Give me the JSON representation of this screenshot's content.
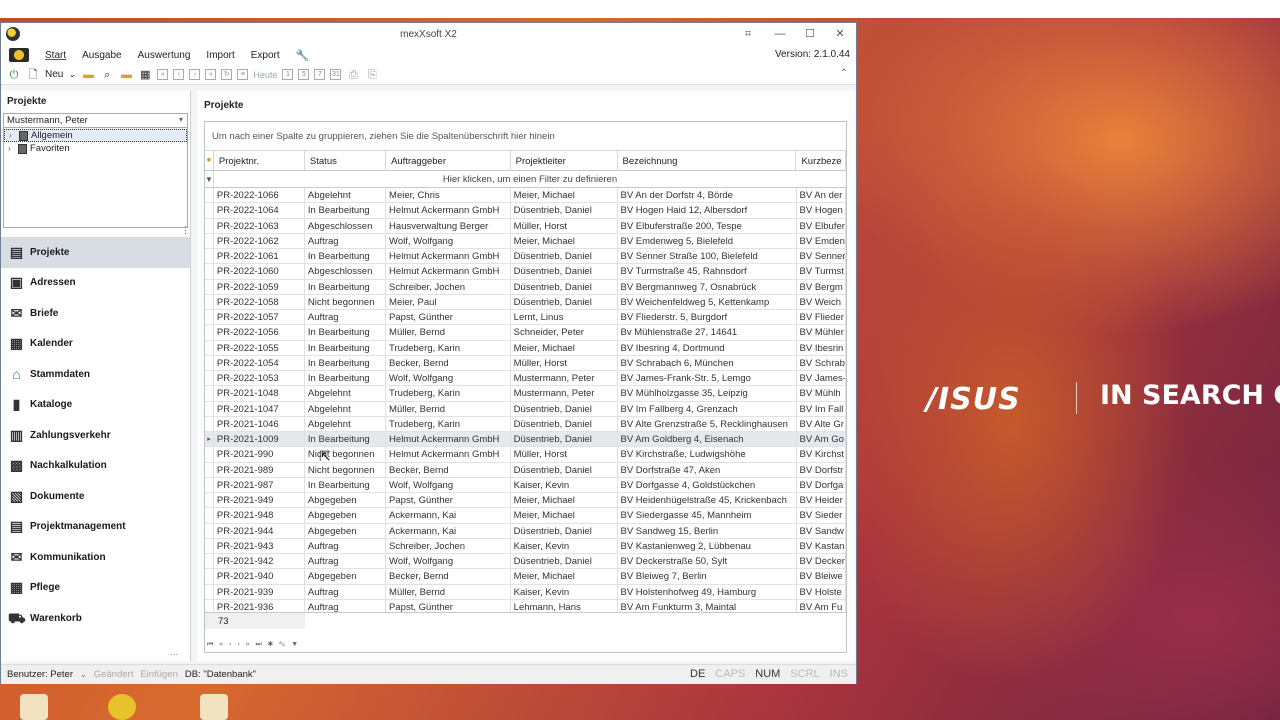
{
  "window": {
    "title": "mexXsoft X2",
    "version": "Version: 2.1.0.44"
  },
  "menu": {
    "tabs": [
      "Start",
      "Ausgabe",
      "Auswertung",
      "Import",
      "Export"
    ],
    "active": "Start"
  },
  "toolbar": {
    "new_label": "Neu",
    "today_label": "Heute"
  },
  "left_panel": {
    "title": "Projekte",
    "user_combo": "Mustermann, Peter",
    "tree": [
      {
        "label": "Allgemein",
        "selected": true
      },
      {
        "label": "Favoriten",
        "selected": false
      }
    ],
    "nav": [
      {
        "label": "Projekte",
        "icon": "folder-icon",
        "active": true
      },
      {
        "label": "Adressen",
        "icon": "address-card-icon"
      },
      {
        "label": "Briefe",
        "icon": "letters-icon"
      },
      {
        "label": "Kalender",
        "icon": "calendar-icon"
      },
      {
        "label": "Stammdaten",
        "icon": "home-icon"
      },
      {
        "label": "Kataloge",
        "icon": "catalog-icon"
      },
      {
        "label": "Zahlungsverkehr",
        "icon": "payment-icon"
      },
      {
        "label": "Nachkalkulation",
        "icon": "calculation-icon"
      },
      {
        "label": "Dokumente",
        "icon": "documents-icon"
      },
      {
        "label": "Projektmanagement",
        "icon": "project-management-icon"
      },
      {
        "label": "Kommunikation",
        "icon": "communication-icon"
      },
      {
        "label": "Pflege",
        "icon": "maintenance-icon"
      },
      {
        "label": "Warenkorb",
        "icon": "cart-icon"
      }
    ],
    "more": "..."
  },
  "content": {
    "title": "Projekte",
    "group_panel_hint": "Um nach einer Spalte zu gruppieren, ziehen Sie die Spaltenüberschrift hier hinein",
    "filter_hint": "Hier klicken, um einen Filter zu definieren",
    "columns": [
      "Projektnr.",
      "Status",
      "Auftraggeber",
      "Projektleiter",
      "Bezeichnung",
      "Kurzbeze"
    ],
    "rows": [
      [
        "PR-2022-1066",
        "Abgelehnt",
        "Meier, Chris",
        "Meier, Michael",
        "BV An der Dorfstr 4, Börde",
        "BV An der"
      ],
      [
        "PR-2022-1064",
        "In Bearbeitung",
        "Helmut Ackermann GmbH",
        "Düsentrieb, Daniel",
        "BV Hogen Haid 12, Albersdorf",
        "BV Hogen"
      ],
      [
        "PR-2022-1063",
        "Abgeschlossen",
        "Hausverwaltung Berger",
        "Müller, Horst",
        "BV Elbuferstraße 200, Tespe",
        "BV Elbufer"
      ],
      [
        "PR-2022-1062",
        "Auftrag",
        "Wolf, Wolfgang",
        "Meier, Michael",
        "BV Emdenweg 5, Bielefeld",
        "BV Emden"
      ],
      [
        "PR-2022-1061",
        "In Bearbeitung",
        "Helmut Ackermann GmbH",
        "Düsentrieb, Daniel",
        "BV Senner Straße 100, Bielefeld",
        "BV Senner"
      ],
      [
        "PR-2022-1060",
        "Abgeschlossen",
        "Helmut Ackermann GmbH",
        "Düsentrieb, Daniel",
        "BV Turmstraße 45, Rahnsdorf",
        "BV Turmst"
      ],
      [
        "PR-2022-1059",
        "In Bearbeitung",
        "Schreiber, Jochen",
        "Düsentrieb, Daniel",
        "BV Bergmannweg 7, Osnabrück",
        "BV Bergm"
      ],
      [
        "PR-2022-1058",
        "Nicht begonnen",
        "Meier, Paul",
        "Düsentrieb, Daniel",
        "BV Weichenfeldweg 5, Kettenkamp",
        "BV Weich"
      ],
      [
        "PR-2022-1057",
        "Auftrag",
        "Papst, Günther",
        "Lernt, Linus",
        "BV Fliederstr. 5, Burgdorf",
        "BV Flieder"
      ],
      [
        "PR-2022-1056",
        "In Bearbeitung",
        "Müller, Bernd",
        "Schneider, Peter",
        "Bv Mühlenstraße 27, 14641",
        "BV Mühler"
      ],
      [
        "PR-2022-1055",
        "In Bearbeitung",
        "Trudeberg, Karin",
        "Meier, Michael",
        "BV Ibesring 4, Dortmund",
        "BV Ibesrin"
      ],
      [
        "PR-2022-1054",
        "In Bearbeitung",
        "Becker, Bernd",
        "Müller, Horst",
        "BV Schrabach 6, München",
        "BV Schrab"
      ],
      [
        "PR-2022-1053",
        "In Bearbeitung",
        "Wolf, Wolfgang",
        "Mustermann, Peter",
        "BV James-Frank-Str. 5, Lemgo",
        "BV James-"
      ],
      [
        "PR-2021-1048",
        "Abgelehnt",
        "Trudeberg, Karin",
        "Mustermann, Peter",
        "BV Mühlholzgasse 35, Leipzig",
        "BV Mühlh"
      ],
      [
        "PR-2021-1047",
        "Abgelehnt",
        "Müller, Bernd",
        "Düsentrieb, Daniel",
        "BV Im Fallberg 4, Grenzach",
        "BV Im Fall"
      ],
      [
        "PR-2021-1046",
        "Abgelehnt",
        "Trudeberg, Karin",
        "Düsentrieb, Daniel",
        "BV Alte Grenzstraße 5, Recklinghausen",
        "BV Alte Gr"
      ],
      [
        "PR-2021-1009",
        "In Bearbeitung",
        "Helmut Ackermann GmbH",
        "Düsentrieb, Daniel",
        "BV Am Goldberg 4, Eisenach",
        "BV Am Go"
      ],
      [
        "PR-2021-990",
        "Nicht begonnen",
        "Helmut Ackermann GmbH",
        "Müller, Horst",
        "BV Kirchstraße, Ludwigshöhe",
        "BV Kirchst"
      ],
      [
        "PR-2021-989",
        "Nicht begonnen",
        "Becker, Bernd",
        "Düsentrieb, Daniel",
        "BV Dorfstraße 47, Aken",
        "BV Dorfstr"
      ],
      [
        "PR-2021-987",
        "In Bearbeitung",
        "Wolf, Wolfgang",
        "Kaiser, Kevin",
        "BV Dorfgasse 4, Goldstückchen",
        "BV Dorfga"
      ],
      [
        "PR-2021-949",
        "Abgegeben",
        "Papst, Günther",
        "Meier, Michael",
        "BV Heidenhügelstraße 45, Krickenbach",
        "BV Heider"
      ],
      [
        "PR-2021-948",
        "Abgegeben",
        "Ackermann, Kai",
        "Meier, Michael",
        "BV Siedergasse 45, Mannheim",
        "BV Sieder"
      ],
      [
        "PR-2021-944",
        "Abgegeben",
        "Ackermann, Kai",
        "Düsentrieb, Daniel",
        "BV Sandweg 15, Berlin",
        "BV Sandw"
      ],
      [
        "PR-2021-943",
        "Auftrag",
        "Schreiber, Jochen",
        "Kaiser, Kevin",
        "BV Kastanienweg 2, Lübbenau",
        "BV Kastan"
      ],
      [
        "PR-2021-942",
        "Auftrag",
        "Wolf, Wolfgang",
        "Düsentrieb, Daniel",
        "BV Deckerstraße 50, Sylt",
        "BV Decker"
      ],
      [
        "PR-2021-940",
        "Abgegeben",
        "Becker, Bernd",
        "Meier, Michael",
        "BV Bleiweg 7, Berlin",
        "BV Bleiwe"
      ],
      [
        "PR-2021-939",
        "Auftrag",
        "Müller, Bernd",
        "Kaiser, Kevin",
        "BV Holstenhofweg 49, Hamburg",
        "BV Holste"
      ],
      [
        "PR-2021-936",
        "Auftrag",
        "Papst, Günther",
        "Lehmann, Hans",
        "BV Am Funkturm 3, Maintal",
        "BV Am Fu"
      ]
    ],
    "current_row": 16,
    "count": "73"
  },
  "statusbar": {
    "user": "Benutzer: Peter",
    "changed": "Geändert",
    "inserted": "Einfügen",
    "db": "DB: \"Datenbank\"",
    "keys": [
      {
        "label": "DE",
        "on": true
      },
      {
        "label": "CAPS",
        "on": false
      },
      {
        "label": "NUM",
        "on": true
      },
      {
        "label": "SCRL",
        "on": false
      },
      {
        "label": "INS",
        "on": false
      }
    ]
  },
  "desktop": {
    "brand": "/ISUS",
    "slogan": "IN SEARCH OF I"
  }
}
